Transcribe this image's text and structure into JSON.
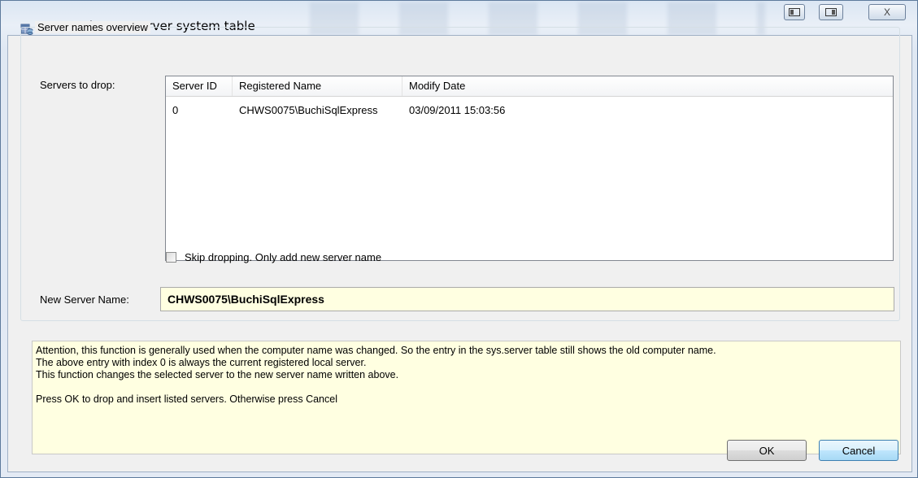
{
  "window": {
    "title": "Names in SQL Server system table",
    "close_glyph": "X"
  },
  "group": {
    "label": "Server names overview"
  },
  "servers_label": "Servers to drop:",
  "servers_table": {
    "columns": [
      "Server ID",
      "Registered Name",
      "Modify Date"
    ],
    "rows": [
      {
        "server_id": "0",
        "registered_name": "CHWS0075\\BuchiSqlExpress",
        "modify_date": "03/09/2011 15:03:56"
      }
    ]
  },
  "skip_checkbox": {
    "label": "Skip dropping. Only add new server name",
    "checked": false
  },
  "new_server": {
    "label": "New Server Name:",
    "value": "CHWS0075\\BuchiSqlExpress"
  },
  "notes": [
    "Attention, this function is generally used when the computer name was changed. So the entry in the sys.server table still shows the old computer name.",
    "The above entry with index 0 is always the current registered local server.",
    "This function changes the selected server to the new server name written above.",
    "",
    "Press OK to drop and insert listed servers. Otherwise press Cancel"
  ],
  "buttons": {
    "ok": "OK",
    "cancel": "Cancel"
  },
  "colors": {
    "input_background": "#ffffe1",
    "dialog_background": "#f0f0f0"
  }
}
